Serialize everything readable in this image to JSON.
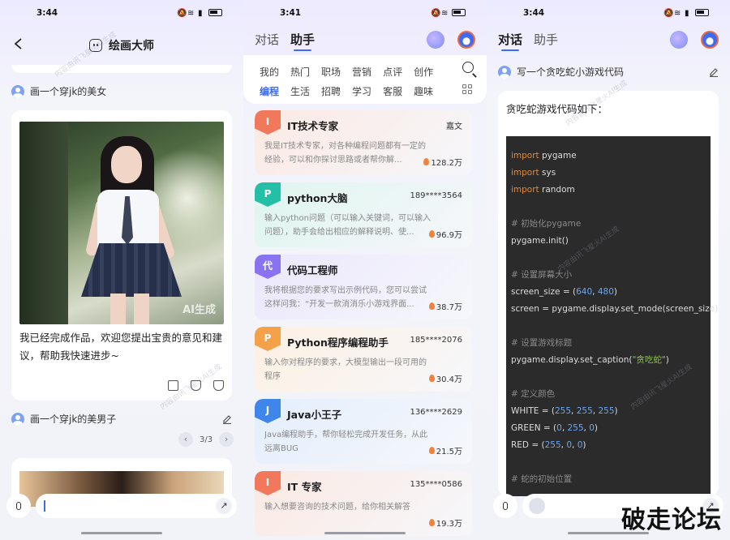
{
  "panel1": {
    "status": {
      "time": "3:44"
    },
    "header": {
      "title": "绘画大师"
    },
    "prompt1": "画一个穿jk的美女",
    "image_badge": "AI生成",
    "result_text": "我已经完成作品，欢迎您提出宝贵的意见和建议，帮助我快速进步~",
    "prompt2": "画一个穿jk的美男子",
    "pager": {
      "prev": "‹",
      "label": "3/3",
      "next": "›"
    },
    "input": {
      "placeholder": ""
    },
    "send_icon": "↗"
  },
  "panel2": {
    "status": {
      "time": "3:41"
    },
    "tabs": [
      "对话",
      "助手"
    ],
    "categories_row1": [
      "我的",
      "热门",
      "职场",
      "营销",
      "点评",
      "创作"
    ],
    "categories_row2": [
      "编程",
      "生活",
      "招聘",
      "学习",
      "客服",
      "趣味"
    ],
    "agents": [
      {
        "badge": "I",
        "name": "IT技术专家",
        "author": "嘉文",
        "desc": "我是IT技术专家，对各种编程问题都有一定的经验，可以和你探讨思路或者帮你解...",
        "heat": "128.2万",
        "color": "#f2785c",
        "bg": "#fbe9e2"
      },
      {
        "badge": "P",
        "name": "python大脑",
        "author": "189****3564",
        "desc": "输入python问题（可以输入关键词，可以输入问题），助手会给出相应的解释说明、使...",
        "heat": "96.9万",
        "color": "#23bfa6",
        "bg": "#def5ef"
      },
      {
        "badge": "代",
        "name": "代码工程师",
        "author": "",
        "desc": "我将根据您的要求写出示例代码，您可以尝试这样问我：“开发一款消消乐小游戏界面...",
        "heat": "38.7万",
        "color": "#8a73f0",
        "bg": "#ebe7fd"
      },
      {
        "badge": "P",
        "name": "Python程序编程助手",
        "author": "185****2076",
        "desc": "输入你对程序的要求，大模型输出一段可用的程序",
        "heat": "30.4万",
        "color": "#f5a14a",
        "bg": "#fdf0e2"
      },
      {
        "badge": "J",
        "name": "Java小王子",
        "author": "136****2629",
        "desc": "Java编程助手，帮你轻松完成开发任务，从此远离BUG",
        "heat": "21.5万",
        "color": "#3e86ea",
        "bg": "#e3eefc"
      },
      {
        "badge": "I",
        "name": "IT 专家",
        "author": "135****0586",
        "desc": "输入想要咨询的技术问题，给你相关解答",
        "heat": "19.3万",
        "color": "#f2785c",
        "bg": "#fbe9e2"
      }
    ]
  },
  "panel3": {
    "status": {
      "time": "3:44"
    },
    "tabs": [
      "对话",
      "助手"
    ],
    "query": "写一个贪吃蛇小游戏代码",
    "intro": "贪吃蛇游戏代码如下：",
    "code": [
      {
        "parts": [
          {
            "t": "import",
            "c": "kw"
          },
          {
            "t": " pygame",
            "c": ""
          }
        ]
      },
      {
        "parts": [
          {
            "t": "import",
            "c": "kw"
          },
          {
            "t": " sys",
            "c": ""
          }
        ]
      },
      {
        "parts": [
          {
            "t": "import",
            "c": "kw"
          },
          {
            "t": " random",
            "c": ""
          }
        ]
      },
      {
        "parts": []
      },
      {
        "parts": [
          {
            "t": "# 初始化pygame",
            "c": "cm"
          }
        ]
      },
      {
        "parts": [
          {
            "t": "pygame.init()",
            "c": ""
          }
        ]
      },
      {
        "parts": []
      },
      {
        "parts": [
          {
            "t": "# 设置屏幕大小",
            "c": "cm"
          }
        ]
      },
      {
        "parts": [
          {
            "t": "screen_size = (",
            "c": ""
          },
          {
            "t": "640",
            "c": "num"
          },
          {
            "t": ", ",
            "c": ""
          },
          {
            "t": "480",
            "c": "num"
          },
          {
            "t": ")",
            "c": ""
          }
        ]
      },
      {
        "parts": [
          {
            "t": "screen = pygame.display.set_mode(screen_size)",
            "c": ""
          }
        ]
      },
      {
        "parts": []
      },
      {
        "parts": [
          {
            "t": "# 设置游戏标题",
            "c": "cm"
          }
        ]
      },
      {
        "parts": [
          {
            "t": "pygame.display.set_caption(",
            "c": ""
          },
          {
            "t": "\"贪吃蛇\"",
            "c": "str"
          },
          {
            "t": ")",
            "c": ""
          }
        ]
      },
      {
        "parts": []
      },
      {
        "parts": [
          {
            "t": "# 定义颜色",
            "c": "cm"
          }
        ]
      },
      {
        "parts": [
          {
            "t": "WHITE = (",
            "c": ""
          },
          {
            "t": "255",
            "c": "num"
          },
          {
            "t": ", ",
            "c": ""
          },
          {
            "t": "255",
            "c": "num"
          },
          {
            "t": ", ",
            "c": ""
          },
          {
            "t": "255",
            "c": "num"
          },
          {
            "t": ")",
            "c": ""
          }
        ]
      },
      {
        "parts": [
          {
            "t": "GREEN = (",
            "c": ""
          },
          {
            "t": "0",
            "c": "num"
          },
          {
            "t": ", ",
            "c": ""
          },
          {
            "t": "255",
            "c": "num"
          },
          {
            "t": ", ",
            "c": ""
          },
          {
            "t": "0",
            "c": "num"
          },
          {
            "t": ")",
            "c": ""
          }
        ]
      },
      {
        "parts": [
          {
            "t": "RED = (",
            "c": ""
          },
          {
            "t": "255",
            "c": "num"
          },
          {
            "t": ", ",
            "c": ""
          },
          {
            "t": "0",
            "c": "num"
          },
          {
            "t": ", ",
            "c": ""
          },
          {
            "t": "0",
            "c": "num"
          },
          {
            "t": ")",
            "c": ""
          }
        ]
      },
      {
        "parts": []
      },
      {
        "parts": [
          {
            "t": "# 蛇的初始位置",
            "c": "cm"
          }
        ]
      }
    ]
  },
  "watermark": "内容由讯飞星火AI生成",
  "site_mark": "破走论坛"
}
